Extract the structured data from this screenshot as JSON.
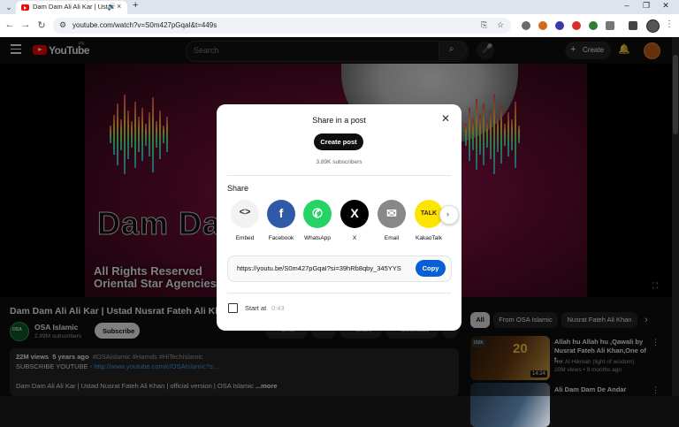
{
  "browser": {
    "tab_title": "Dam Dam Ali Ali Kar | Ustad",
    "tab_audio_icon": "🔊",
    "tab_close": "×",
    "new_tab": "+",
    "url": "youtube.com/watch?v=S0m427pGqaI&t=449s"
  },
  "header": {
    "wordmark": "YouTube",
    "region": "PK",
    "search_placeholder": "Search",
    "create_label": "Create"
  },
  "video": {
    "overlay_title": "Dam Dam Ali Ali Kar",
    "rights_line1": "All Rights Reserved",
    "rights_line2": "Oriental Star Agencies",
    "title": "Dam Dam Ali Ali Kar | Ustad Nusrat Fateh Ali Khan",
    "channel_name": "OSA Islamic",
    "channel_avatar_text": "OSA",
    "channel_subs": "2.89M subscribers",
    "subscribe_label": "Subscribe",
    "action_labels": [
      "1.4M",
      "Share",
      "Download"
    ]
  },
  "description": {
    "views": "22M views",
    "age": "5 years ago",
    "tags": "#OSAislamic #Hamds #HiTechislamic",
    "line2_prefix": "SUBSCRIBE YOUTUBE - ",
    "line2_link": "http://www.youtube.com/c/OSAIslamic?s...",
    "line3": "Dam Dam Ali Ali Kar | Ustad Nusrat Fateh Ali Khan | official version | OSA Islamic",
    "more": "...more"
  },
  "chips": [
    "All",
    "From OSA Islamic",
    "Nusrat Fateh Ali Khan"
  ],
  "recommendations": [
    {
      "title": "Allah hu Allah hu ,Qawali by Nusrat Fateh Ali Khan,One of t...",
      "channel": "Nur Al Hikmah (light of wisdom)",
      "meta": "20M views • 9 months ago",
      "duration": "14:24",
      "badge": "150K",
      "thumb_text": "20"
    },
    {
      "title": "Ali Dam Dam De Andar",
      "channel": "",
      "meta": "",
      "duration": "",
      "badge": "",
      "thumb_text": ""
    }
  ],
  "modal": {
    "title": "Share in a post",
    "create_post": "Create post",
    "subscribers": "3.89K subscribers",
    "share_label": "Share",
    "share_targets": [
      {
        "label": "Embed",
        "glyph": "<>",
        "color": "#f2f2f2",
        "fg": "#333333"
      },
      {
        "label": "Facebook",
        "glyph": "f",
        "color": "#1877f2",
        "fg": "#ffffff"
      },
      {
        "label": "WhatsApp",
        "glyph": "✆",
        "color": "#25d366",
        "fg": "#ffffff"
      },
      {
        "label": "X",
        "glyph": "X",
        "color": "#000000",
        "fg": "#ffffff"
      },
      {
        "label": "Email",
        "glyph": "✉",
        "color": "#888888",
        "fg": "#ffffff"
      },
      {
        "label": "KakaoTalk",
        "glyph": "TALK",
        "color": "#fee500",
        "fg": "#3c1e1e"
      }
    ],
    "share_url": "https://youtu.be/S0m427pGqaI?si=39hRb8qby_345YYS",
    "copy_label": "Copy",
    "start_at_label": "Start at",
    "start_time": "0:43"
  }
}
